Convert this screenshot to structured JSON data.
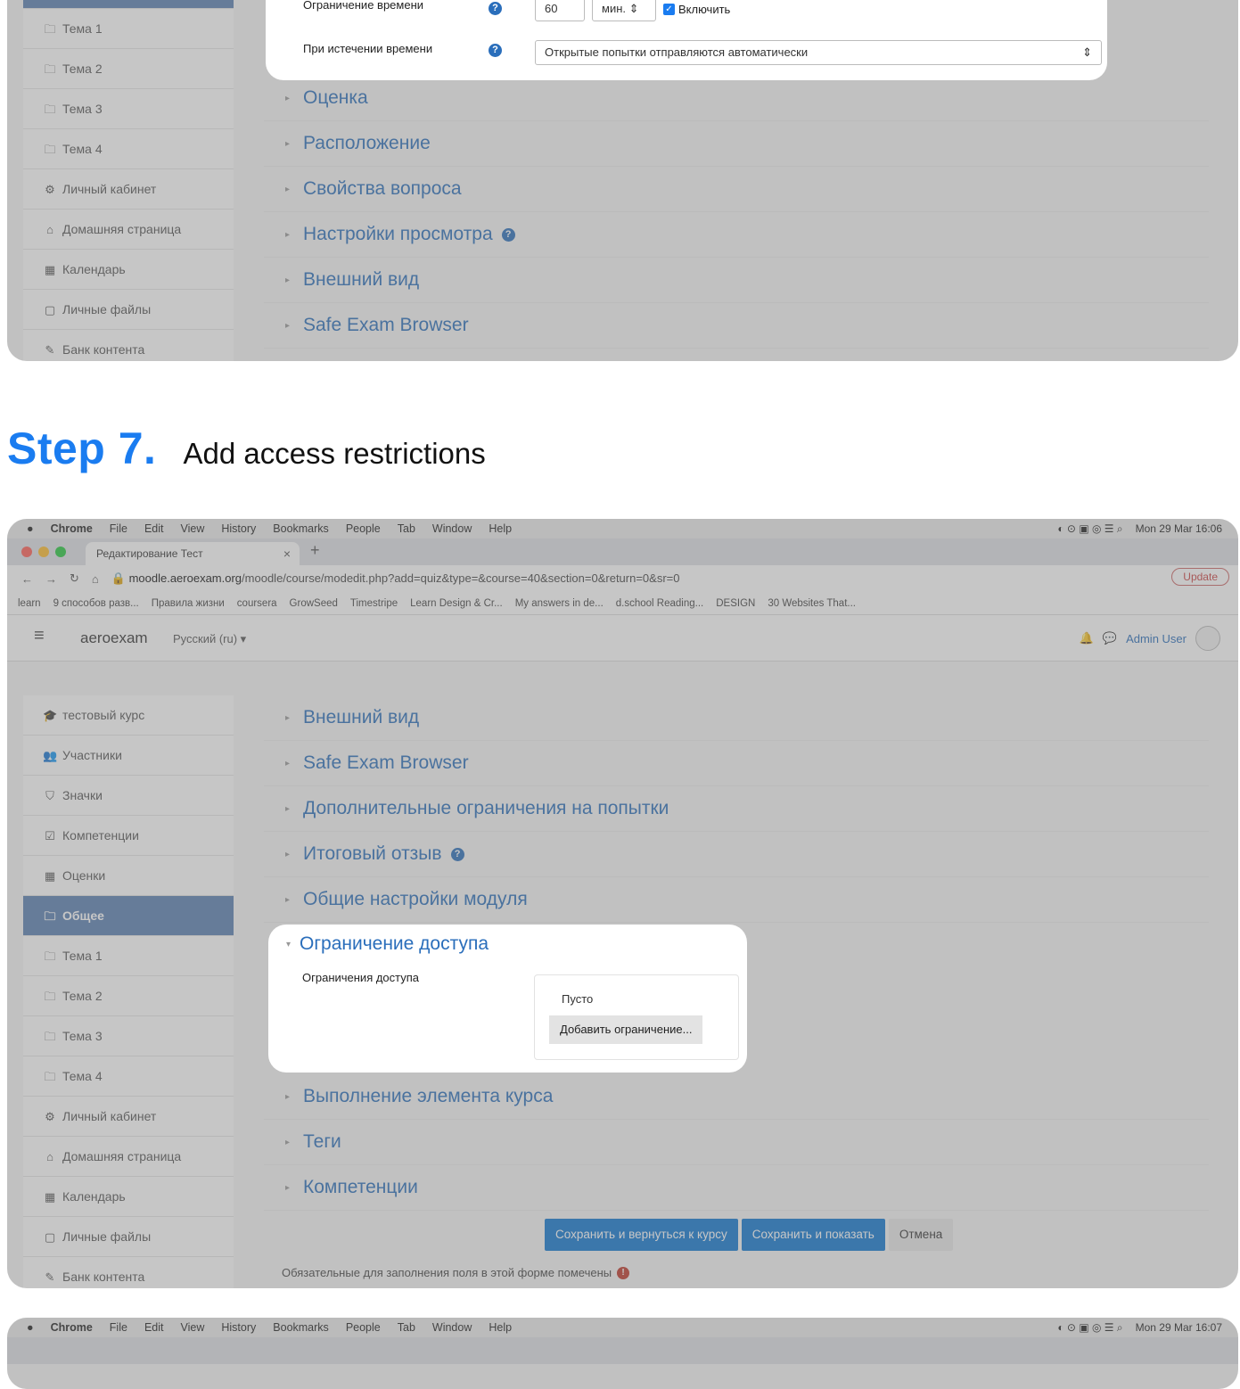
{
  "colors": {
    "accent": "#1a7cf0",
    "moodle_blue": "#2a6ebb",
    "sidebar_active": "#5b80b2",
    "button_primary": "#1177d1"
  },
  "shot1": {
    "sidebar_items": [
      {
        "icon": "folder-icon",
        "glyph": "🗀",
        "label": "Тема 1"
      },
      {
        "icon": "folder-icon",
        "glyph": "🗀",
        "label": "Тема 2"
      },
      {
        "icon": "folder-icon",
        "glyph": "🗀",
        "label": "Тема 3"
      },
      {
        "icon": "folder-icon",
        "glyph": "🗀",
        "label": "Тема 4"
      },
      {
        "icon": "dashboard-icon",
        "glyph": "⚙",
        "label": "Личный кабинет"
      },
      {
        "icon": "home-icon",
        "glyph": "⌂",
        "label": "Домашняя страница"
      },
      {
        "icon": "calendar-icon",
        "glyph": "▦",
        "label": "Календарь"
      },
      {
        "icon": "file-icon",
        "glyph": "▢",
        "label": "Личные файлы"
      },
      {
        "icon": "pencil-icon",
        "glyph": "✎",
        "label": "Банк контента"
      }
    ],
    "time_limit_label": "Ограничение времени",
    "time_limit_value": "60",
    "time_unit": "мин. ⇕",
    "enable_label": "Включить",
    "on_expire_label": "При истечении времени",
    "on_expire_value": "Открытые попытки отправляются автоматически",
    "sections": [
      "Оценка",
      "Расположение",
      "Свойства вопроса",
      "Настройки просмотра",
      "Внешний вид",
      "Safe Exam Browser"
    ]
  },
  "heading": {
    "step": "Step 7.",
    "text": "Add access restrictions"
  },
  "shot2": {
    "menubar": {
      "items": [
        "Chrome",
        "File",
        "Edit",
        "View",
        "History",
        "Bookmarks",
        "People",
        "Tab",
        "Window",
        "Help"
      ],
      "clock": "Mon 29 Mar 16:06"
    },
    "tab_title": "Редактирование Тест",
    "url_domain": "moodle.aeroexam.org",
    "url_path": "/moodle/course/modedit.php?add=quiz&type=&course=40&section=0&return=0&sr=0",
    "update_label": "Update",
    "bookmarks": [
      "learn",
      "9 способов разв...",
      "Правила жизни",
      "coursera",
      "GrowSeed",
      "Timestripe",
      "Learn Design & Cr...",
      "My answers in de...",
      "d.school Reading...",
      "DESIGN",
      "30 Websites That..."
    ],
    "brand": "aeroexam",
    "language": "Русский (ru) ▾",
    "user_name": "Admin User",
    "sidebar_items": [
      {
        "icon": "graduation-cap-icon",
        "glyph": "🎓",
        "label": "тестовый курс",
        "active": false
      },
      {
        "icon": "users-icon",
        "glyph": "👥",
        "label": "Участники",
        "active": false
      },
      {
        "icon": "badge-icon",
        "glyph": "⛉",
        "label": "Значки",
        "active": false
      },
      {
        "icon": "checkbox-icon",
        "glyph": "☑",
        "label": "Компетенции",
        "active": false
      },
      {
        "icon": "grid-icon",
        "glyph": "▦",
        "label": "Оценки",
        "active": false
      },
      {
        "icon": "folder-icon",
        "glyph": "🗀",
        "label": "Общее",
        "active": true
      },
      {
        "icon": "folder-icon",
        "glyph": "🗀",
        "label": "Тема 1",
        "active": false
      },
      {
        "icon": "folder-icon",
        "glyph": "🗀",
        "label": "Тема 2",
        "active": false
      },
      {
        "icon": "folder-icon",
        "glyph": "🗀",
        "label": "Тема 3",
        "active": false
      },
      {
        "icon": "folder-icon",
        "glyph": "🗀",
        "label": "Тема 4",
        "active": false
      },
      {
        "icon": "dashboard-icon",
        "glyph": "⚙",
        "label": "Личный кабинет",
        "active": false
      },
      {
        "icon": "home-icon",
        "glyph": "⌂",
        "label": "Домашняя страница",
        "active": false
      },
      {
        "icon": "calendar-icon",
        "glyph": "▦",
        "label": "Календарь",
        "active": false
      },
      {
        "icon": "file-icon",
        "glyph": "▢",
        "label": "Личные файлы",
        "active": false
      },
      {
        "icon": "pencil-icon",
        "glyph": "✎",
        "label": "Банк контента",
        "active": false
      }
    ],
    "sections_top": [
      "Внешний вид",
      "Safe Exam Browser",
      "Дополнительные ограничения на попытки",
      "Итоговый отзыв",
      "Общие настройки модуля"
    ],
    "restrict_title": "Ограничение доступа",
    "restrict_label": "Ограничения доступа",
    "restrict_empty": "Пусто",
    "restrict_add": "Добавить ограничение...",
    "sections_bottom": [
      "Выполнение элемента курса",
      "Теги",
      "Компетенции"
    ],
    "btn_save_return": "Сохранить и вернуться к курсу",
    "btn_save_show": "Сохранить и показать",
    "btn_cancel": "Отмена",
    "required_note": "Обязательные для заполнения поля в этой форме помечены"
  },
  "shot3": {
    "menubar": {
      "items": [
        "Chrome",
        "File",
        "Edit",
        "View",
        "History",
        "Bookmarks",
        "People",
        "Tab",
        "Window",
        "Help"
      ],
      "clock": "Mon 29 Mar 16:07"
    }
  }
}
